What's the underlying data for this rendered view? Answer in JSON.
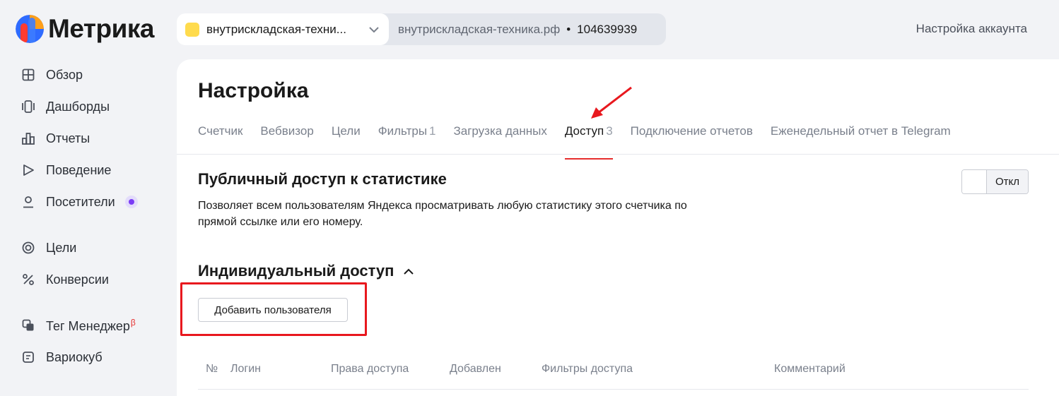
{
  "logo": {
    "text": "Метрика"
  },
  "counter": {
    "selected_name": "внутрискладская-техни...",
    "domain": "внутрискладская-техника.рф",
    "separator": "•",
    "id": "104639939"
  },
  "header": {
    "account_settings": "Настройка аккаунта"
  },
  "sidebar": {
    "items": [
      {
        "label": "Обзор",
        "icon": "grid-icon"
      },
      {
        "label": "Дашборды",
        "icon": "dashboards-icon"
      },
      {
        "label": "Отчеты",
        "icon": "reports-icon"
      },
      {
        "label": "Поведение",
        "icon": "play-icon"
      },
      {
        "label": "Посетители",
        "icon": "user-icon"
      },
      {
        "label": "Цели",
        "icon": "target-icon"
      },
      {
        "label": "Конверсии",
        "icon": "percent-icon"
      },
      {
        "label": "Тег Менеджер",
        "icon": "tag-manager-icon",
        "badge": "β"
      },
      {
        "label": "Вариокуб",
        "icon": "variocube-icon"
      }
    ]
  },
  "page": {
    "title": "Настройка",
    "tabs": [
      {
        "label": "Счетчик",
        "count": ""
      },
      {
        "label": "Вебвизор",
        "count": ""
      },
      {
        "label": "Цели",
        "count": ""
      },
      {
        "label": "Фильтры",
        "count": "1"
      },
      {
        "label": "Загрузка данных",
        "count": ""
      },
      {
        "label": "Доступ",
        "count": "3",
        "active": true
      },
      {
        "label": "Подключение отчетов",
        "count": ""
      },
      {
        "label": "Еженедельный отчет в Telegram",
        "count": ""
      }
    ]
  },
  "public_access": {
    "title": "Публичный доступ к статистике",
    "description": "Позволяет всем пользователям Яндекса просматривать любую статистику этого счетчика по прямой ссылке или его номеру.",
    "toggle_state": "Откл"
  },
  "individual_access": {
    "title": "Индивидуальный доступ",
    "add_button": "Добавить пользователя",
    "columns": [
      "№",
      "Логин",
      "Права доступа",
      "Добавлен",
      "Фильтры доступа",
      "Комментарий"
    ]
  },
  "colors": {
    "accent_red": "#e62e2e",
    "annotation_red": "#e8181e",
    "counter_yellow": "#ffdb4d",
    "badge_purple": "#7b3cf5"
  }
}
